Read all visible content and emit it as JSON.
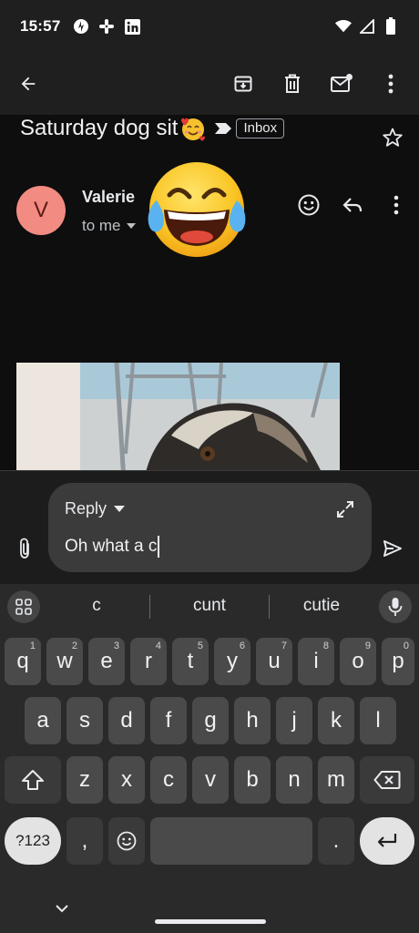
{
  "status_bar": {
    "time": "15:57"
  },
  "email": {
    "subject": "Saturday dog sit",
    "label": "Inbox",
    "sender_initial": "V",
    "sender_name": "Valerie",
    "recipient": "to me"
  },
  "reply": {
    "mode_label": "Reply",
    "draft_text": "Oh what a c"
  },
  "keyboard": {
    "suggestions": [
      "c",
      "cunt",
      "cutie"
    ],
    "row1": [
      {
        "key": "q",
        "hint": "1"
      },
      {
        "key": "w",
        "hint": "2"
      },
      {
        "key": "e",
        "hint": "3"
      },
      {
        "key": "r",
        "hint": "4"
      },
      {
        "key": "t",
        "hint": "5"
      },
      {
        "key": "y",
        "hint": "6"
      },
      {
        "key": "u",
        "hint": "7"
      },
      {
        "key": "i",
        "hint": "8"
      },
      {
        "key": "o",
        "hint": "9"
      },
      {
        "key": "p",
        "hint": "0"
      }
    ],
    "row2": [
      "a",
      "s",
      "d",
      "f",
      "g",
      "h",
      "j",
      "k",
      "l"
    ],
    "row3": [
      "z",
      "x",
      "c",
      "v",
      "b",
      "n",
      "m"
    ],
    "symbols_label": "?123",
    "comma": ",",
    "period": "."
  },
  "colors": {
    "avatar": "#f28b82",
    "app_bar": "#1f1f1f",
    "keyboard": "#2a2a2a"
  },
  "icons": [
    "back-arrow-icon",
    "archive-icon",
    "delete-icon",
    "mark-unread-icon",
    "more-vert-icon",
    "star-icon",
    "emoji-react-icon",
    "reply-icon",
    "paperclip-icon",
    "expand-icon",
    "send-icon",
    "apps-grid-icon",
    "mic-icon",
    "shift-icon",
    "backspace-icon",
    "emoji-key-icon",
    "enter-icon"
  ]
}
